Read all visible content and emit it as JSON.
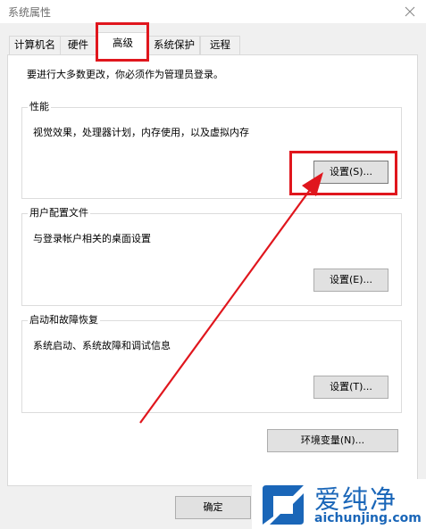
{
  "window": {
    "title": "系统属性",
    "close_icon": "close-icon"
  },
  "tabs": [
    {
      "label": "计算机名"
    },
    {
      "label": "硬件"
    },
    {
      "label": "高级"
    },
    {
      "label": "系统保护"
    },
    {
      "label": "远程"
    }
  ],
  "active_tab": "高级",
  "intro": "要进行大多数更改，你必须作为管理员登录。",
  "groups": {
    "performance": {
      "title": "性能",
      "description": "视觉效果，处理器计划，内存使用，以及虚拟内存",
      "button": "设置(S)..."
    },
    "user_profiles": {
      "title": "用户配置文件",
      "description": "与登录帐户相关的桌面设置",
      "button": "设置(E)..."
    },
    "startup_recovery": {
      "title": "启动和故障恢复",
      "description": "系统启动、系统故障和调试信息",
      "button": "设置(T)..."
    }
  },
  "env_button": "环境变量(N)...",
  "footer": {
    "ok_button": "确定"
  },
  "watermark": {
    "brand": "爱纯净",
    "url": "aichunjing.com",
    "color": "#1a66b8"
  },
  "annotation_color": "#e0161d"
}
